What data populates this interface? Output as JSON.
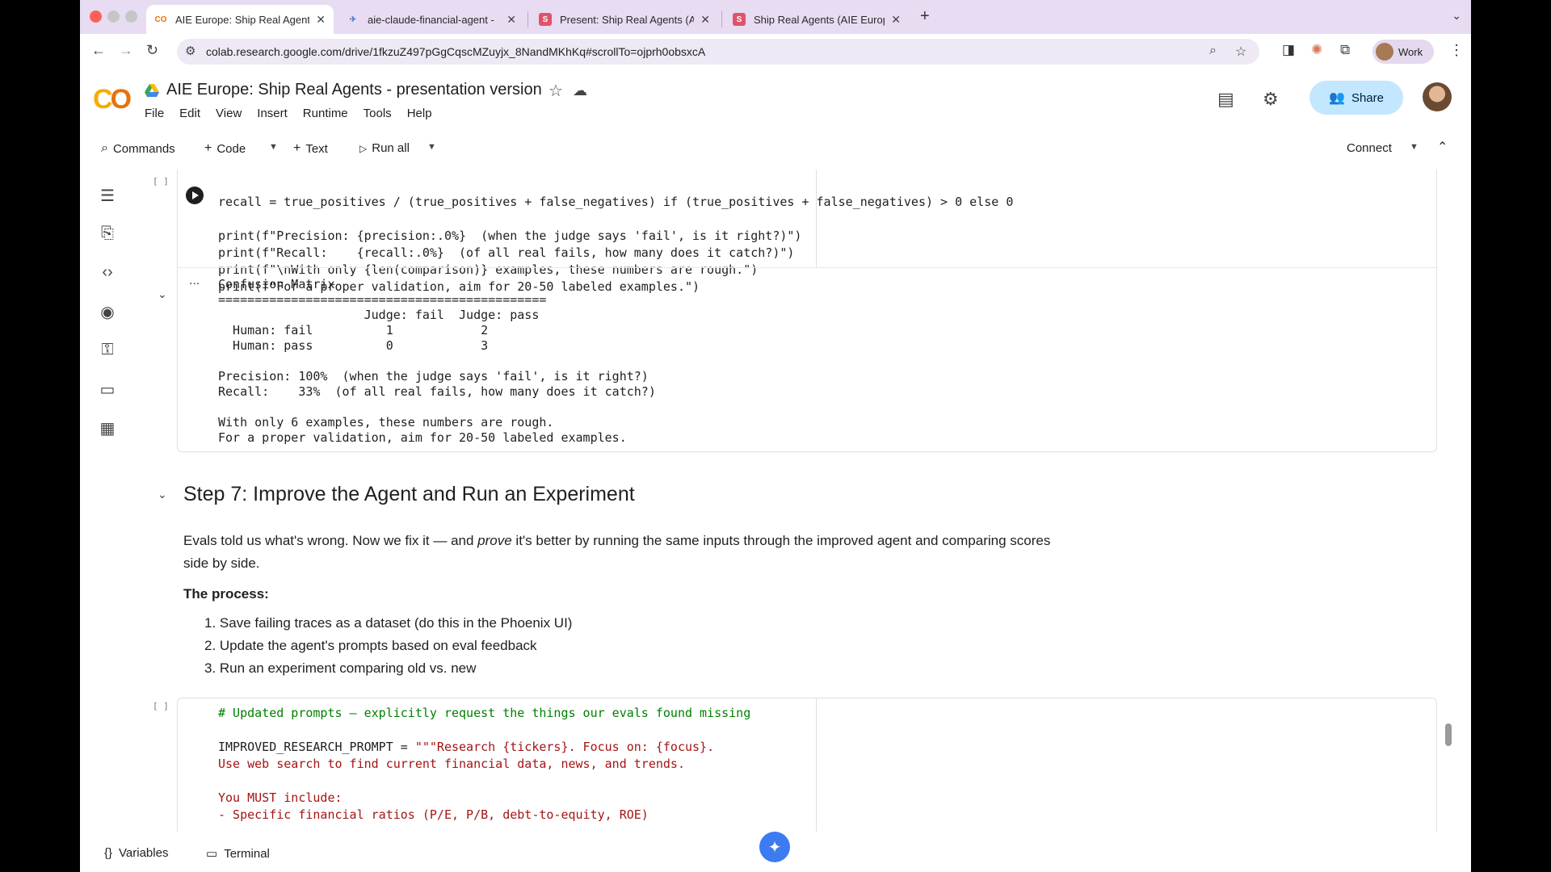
{
  "browser": {
    "tabs": [
      {
        "title": "AIE Europe: Ship Real Agents",
        "favicon": "CO",
        "active": true
      },
      {
        "title": "aie-claude-financial-agent -",
        "favicon": "✈",
        "active": false
      },
      {
        "title": "Present: Ship Real Agents (A",
        "favicon": "S",
        "active": false
      },
      {
        "title": "Ship Real Agents (AIE Europe",
        "favicon": "S",
        "active": false
      }
    ],
    "url": "colab.research.google.com/drive/1fkzuZ497pGgCqscMZuyjx_8NandMKhKq#scrollTo=ojprh0obsxcA",
    "profile_label": "Work"
  },
  "colab": {
    "title": "AIE Europe: Ship Real Agents - presentation version",
    "menu": [
      "File",
      "Edit",
      "View",
      "Insert",
      "Runtime",
      "Tools",
      "Help"
    ],
    "share_label": "Share",
    "toolbar": {
      "commands": "Commands",
      "code": "Code",
      "text": "Text",
      "run_all": "Run all",
      "connect": "Connect"
    }
  },
  "cell1": {
    "bracket": "[ ]",
    "lines": [
      "recall = true_positives / (true_positives + false_negatives) if (true_positives + false_negatives) > 0 else 0",
      "",
      "print(f\"Precision: {precision:.0%}  (when the judge says 'fail', is it right?)\")",
      "print(f\"Recall:    {recall:.0%}  (of all real fails, how many does it catch?)\")",
      "print(f\"\\nWith only {len(comparison)} examples, these numbers are rough.\")",
      "print(f\"For a proper validation, aim for 20-50 labeled examples.\")"
    ],
    "output_ellipsis": "...",
    "output": "Confusion Matrix\n=============================================\n                    Judge: fail  Judge: pass\n  Human: fail          1            2\n  Human: pass          0            3\n\nPrecision: 100%  (when the judge says 'fail', is it right?)\nRecall:    33%  (of all real fails, how many does it catch?)\n\nWith only 6 examples, these numbers are rough.\nFor a proper validation, aim for 20-50 labeled examples."
  },
  "markdown": {
    "heading": "Step 7: Improve the Agent and Run an Experiment",
    "para_before": "Evals told us what's wrong. Now we fix it — and ",
    "para_em": "prove",
    "para_after": " it's better by running the same inputs through the improved agent and comparing scores side by side.",
    "process_label": "The process:",
    "steps": [
      "1. Save failing traces as a dataset (do this in the Phoenix UI)",
      "2. Update the agent's prompts based on eval feedback",
      "3. Run an experiment comparing old vs. new"
    ]
  },
  "cell2": {
    "bracket": "[ ]",
    "comment": "# Updated prompts — explicitly request the things our evals found missing",
    "var": "IMPROVED_RESEARCH_PROMPT",
    "assign": " = ",
    "str1": "\"\"\"Research {tickers}. Focus on: {focus}.",
    "str2": "Use web search to find current financial data, news, and trends.",
    "str3": "You MUST include:",
    "str4": "- Specific financial ratios (P/E, P/B, debt-to-equity, ROE)"
  },
  "bottom": {
    "variables": "Variables",
    "terminal": "Terminal"
  },
  "colors": {
    "share_bg": "#c2e7ff",
    "tabstrip": "#e7dcf2",
    "accent": "#3c7bf2"
  }
}
